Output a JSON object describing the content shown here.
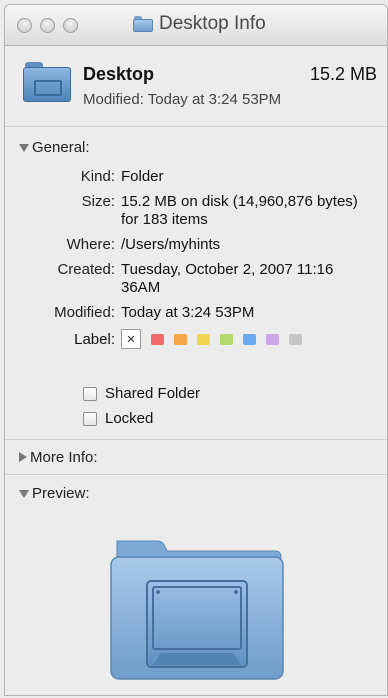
{
  "window": {
    "title": "Desktop Info"
  },
  "summary": {
    "name": "Desktop",
    "size": "15.2 MB",
    "modified": "Modified: Today at 3:24 53PM"
  },
  "general": {
    "heading": "General:",
    "rows": [
      {
        "key": "Kind:",
        "value": "Folder"
      },
      {
        "key": "Size:",
        "value": "15.2 MB on disk (14,960,876 bytes) for 183 items"
      },
      {
        "key": "Where:",
        "value": "/Users/myhints"
      },
      {
        "key": "Created:",
        "value": "Tuesday, October 2, 2007 11:16 36AM"
      },
      {
        "key": "Modified:",
        "value": "Today at 3:24 53PM"
      }
    ],
    "label_key": "Label:",
    "label_none_glyph": "×",
    "label_colors": [
      "#f06a6a",
      "#f5a646",
      "#f2d652",
      "#b5d96a",
      "#6aa9ee",
      "#cda6e6",
      "#c6c6c6"
    ],
    "checkboxes": [
      {
        "label": "Shared Folder",
        "checked": false
      },
      {
        "label": "Locked",
        "checked": false
      }
    ]
  },
  "more_info": {
    "heading": "More Info:"
  },
  "preview": {
    "heading": "Preview:"
  }
}
